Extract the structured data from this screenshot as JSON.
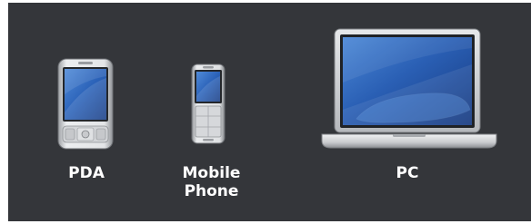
{
  "devices": [
    {
      "id": "pda",
      "label": "PDA",
      "icon": "pda-icon"
    },
    {
      "id": "mobile-phone",
      "label": "Mobile\nPhone",
      "label_lines": [
        "Mobile",
        "Phone"
      ],
      "icon": "mobile-phone-icon"
    },
    {
      "id": "pc",
      "label": "PC",
      "icon": "laptop-icon"
    }
  ],
  "colors": {
    "background": "#34363a",
    "label": "#ffffff",
    "screen": "#2a5db0",
    "body": "#d9dadc"
  }
}
